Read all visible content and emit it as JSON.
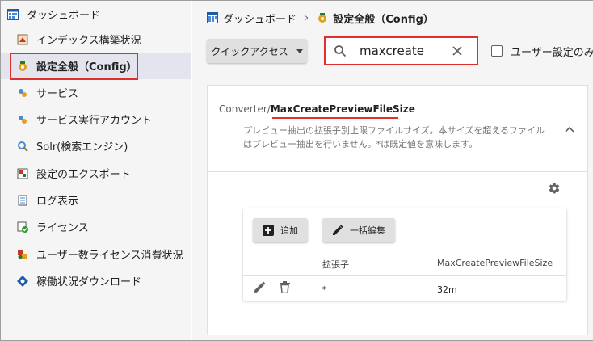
{
  "sidebar": {
    "items": [
      {
        "label": "ダッシュボード",
        "icon": "dashboard-icon"
      },
      {
        "label": "インデックス構築状況",
        "icon": "index-icon"
      },
      {
        "label": "設定全般（Config）",
        "icon": "config-icon"
      },
      {
        "label": "サービス",
        "icon": "service-icon"
      },
      {
        "label": "サービス実行アカウント",
        "icon": "service-account-icon"
      },
      {
        "label": "Solr(検索エンジン)",
        "icon": "solr-icon"
      },
      {
        "label": "設定のエクスポート",
        "icon": "export-icon"
      },
      {
        "label": "ログ表示",
        "icon": "log-icon"
      },
      {
        "label": "ライセンス",
        "icon": "license-icon"
      },
      {
        "label": "ユーザー数ライセンス消費状況",
        "icon": "user-license-icon"
      },
      {
        "label": "稼働状況ダウンロード",
        "icon": "download-icon"
      }
    ]
  },
  "breadcrumb": {
    "root": "ダッシュボード",
    "separator": "›",
    "current": "設定全般（Config）"
  },
  "toolbar": {
    "quick_access_label": "クイックアクセス",
    "search_value": "maxcreate",
    "user_settings_only_label": "ユーザー設定のみ表示"
  },
  "setting": {
    "prefix": "Converter/",
    "name": "MaxCreatePreviewFileSize",
    "description": "プレビュー抽出の拡張子別上限ファイルサイズ。本サイズを超えるファイルはプレビュー抽出を行いません。*は既定値を意味します。"
  },
  "table": {
    "add_label": "追加",
    "bulk_edit_label": "一括編集",
    "headers": [
      "拡張子",
      "MaxCreatePreviewFileSize"
    ],
    "rows": [
      {
        "ext": "*",
        "value": "32m"
      }
    ]
  },
  "colors": {
    "highlight": "#e0302d",
    "active_bg": "#e3e4ee"
  }
}
